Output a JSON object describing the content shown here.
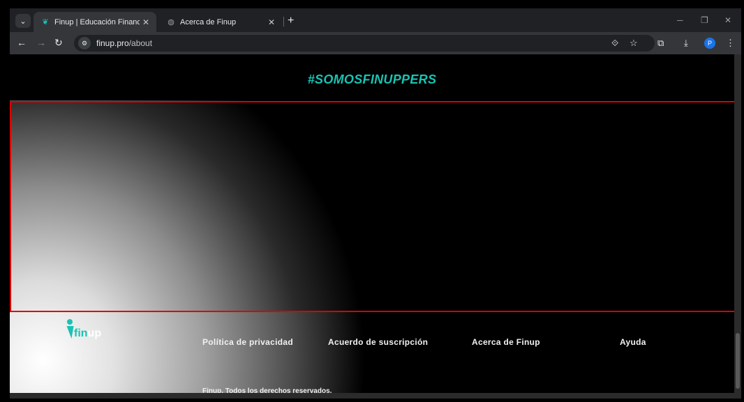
{
  "browser": {
    "tabs": [
      {
        "title": "Finup | Educación Financiera",
        "active": true,
        "favicon": "finup-logo-icon"
      },
      {
        "title": "Acerca de Finup",
        "active": false,
        "favicon": "globe-icon"
      }
    ],
    "url": {
      "host": "finup.pro",
      "path": "/about"
    },
    "profile_initial": "P"
  },
  "page": {
    "hashtag": "#SOMOSFINUPPERS",
    "colors": {
      "accent": "#19c3b4",
      "highlight": "#e00000"
    }
  },
  "footer": {
    "logo": {
      "fin": "fin",
      "up": "up"
    },
    "links": [
      "Política de privacidad",
      "Acuerdo de suscripción",
      "Acerca de Finup",
      "Ayuda"
    ],
    "copyright": "Finup. Todos los derechos reservados."
  }
}
